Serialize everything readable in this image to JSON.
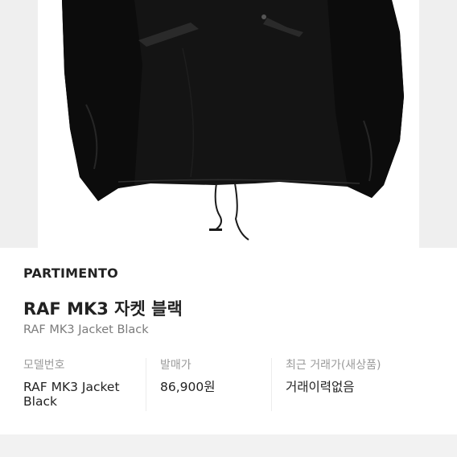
{
  "product": {
    "brand": "PARTIMENTO",
    "name": "RAF MK3 자켓 블랙",
    "name_en": "RAF MK3 Jacket Black"
  },
  "details": [
    {
      "label": "모델번호",
      "value": "RAF MK3 Jacket Black"
    },
    {
      "label": "발매가",
      "value": "86,900원"
    },
    {
      "label": "최근 거래가(새상품)",
      "value": "거래이력없음"
    }
  ],
  "image": {
    "subject": "black-jacket-photo",
    "jacket_color": "#111111",
    "frame_bg": "#efefef"
  }
}
